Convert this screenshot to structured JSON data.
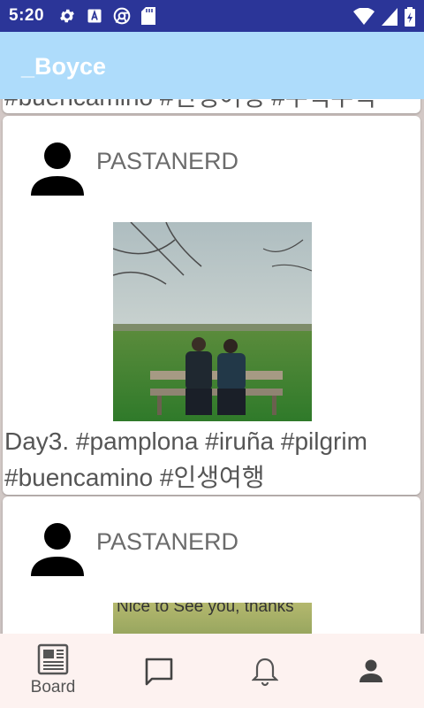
{
  "status_bar": {
    "time": "5:20",
    "icons_left": [
      "gear-icon",
      "a-icon",
      "chrome-icon",
      "sd-card-icon"
    ],
    "icons_right": [
      "wifi-icon",
      "signal-icon",
      "battery-icon"
    ]
  },
  "app_bar": {
    "title": "_Boyce",
    "color": "#aedcfb"
  },
  "feed": {
    "posts": [
      {
        "caption": "#buencamino #인생여행 #우럭우럭"
      },
      {
        "author": "PASTANERD",
        "caption": "Day3. #pamplona #iruña #pilgrim #buencamino #인생여행"
      },
      {
        "author": "PASTANERD",
        "image_text": "Nice to See you, thanks"
      }
    ]
  },
  "bottom_nav": {
    "items": [
      {
        "label": "Board",
        "icon": "newspaper-icon"
      },
      {
        "label": "",
        "icon": "chat-icon"
      },
      {
        "label": "",
        "icon": "bell-icon"
      },
      {
        "label": "",
        "icon": "person-icon"
      }
    ]
  }
}
